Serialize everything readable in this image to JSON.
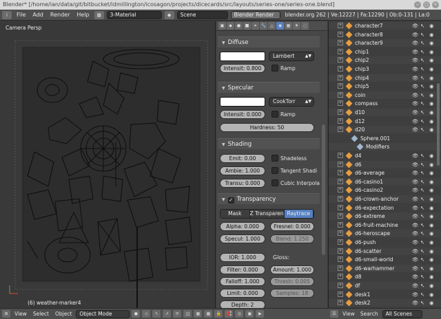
{
  "window": {
    "title": "Blender* [/home/ian/data/git/bitbucket/idmillington/icosagon/projects/dicecards/src/layouts/series-one/series-one.blend]",
    "controls": [
      "−",
      "□",
      "×"
    ]
  },
  "infobar": {
    "menus": [
      "File",
      "Add",
      "Render",
      "Help"
    ],
    "layout": "3-Material",
    "scene": "Scene",
    "engine": "Blender Render",
    "stats": "blender.org 262 | Ve:12227 | Fa:12290 | Ob:0-131 | La:0"
  },
  "viewport": {
    "view_label": "Camera Persp",
    "object_label": "(6) weather-marker4"
  },
  "viewport_header": {
    "menus": [
      "View",
      "Select",
      "Object"
    ],
    "mode": "Object Mode"
  },
  "properties": {
    "tabs": [
      "render",
      "scene",
      "world",
      "object",
      "constraints",
      "modifiers",
      "data",
      "material",
      "texture",
      "particles",
      "physics"
    ],
    "diffuse": {
      "title": "Diffuse",
      "shader": "Lambert",
      "intensity": "Intensit: 0.800",
      "ramp": "Ramp"
    },
    "specular": {
      "title": "Specular",
      "shader": "CookTorr",
      "intensity": "Intensit: 0.000",
      "ramp": "Ramp",
      "hardness": "Hardness: 50"
    },
    "shading": {
      "title": "Shading",
      "emit": "Emit: 0.00",
      "shadeless": "Shadeless",
      "ambient": "Ambie: 1.000",
      "tangent": "Tangent Shadi",
      "translucency": "Transu: 0.000",
      "cubic": "Cubic Interpola"
    },
    "transparency": {
      "title": "Transparency",
      "modes": [
        "Mask",
        "Z Transparen",
        "Raytrace"
      ],
      "active_mode": 2,
      "alpha": "Alpha: 0.000",
      "fresnel": "Fresnel: 0.000",
      "specular": "Specul: 1.000",
      "blend": "Blend: 1.250",
      "ior": "IOR: 1.000",
      "gloss_label": "Gloss:",
      "amount": "Amount: 1.000",
      "filter": "Filter: 0.000",
      "thresh": "Thresh: 0.005",
      "falloff": "Falloff: 1.000",
      "samples": "Samples: 18",
      "limit": "Limit: 0.000",
      "depth": "Depth: 2"
    }
  },
  "outliner": {
    "items": [
      "character7",
      "character8",
      "character9",
      "chip1",
      "chip2",
      "chip3",
      "chip4",
      "chip5",
      "coin",
      "compass",
      "d10",
      "d12",
      "d20",
      "Sphere.001",
      "Modifiers",
      "d4",
      "d6",
      "d6-average",
      "d6-casino1",
      "d6-casino2",
      "d6-crown-anchor",
      "d6-expectation",
      "d6-extreme",
      "d6-fruit-machine",
      "d6-heroscape",
      "d6-push",
      "d6-scatter",
      "d6-small-world",
      "d6-warhammer",
      "d8",
      "df",
      "desk1",
      "desk2"
    ],
    "header_menus": [
      "View",
      "Search"
    ],
    "filter": "All Scenes"
  }
}
